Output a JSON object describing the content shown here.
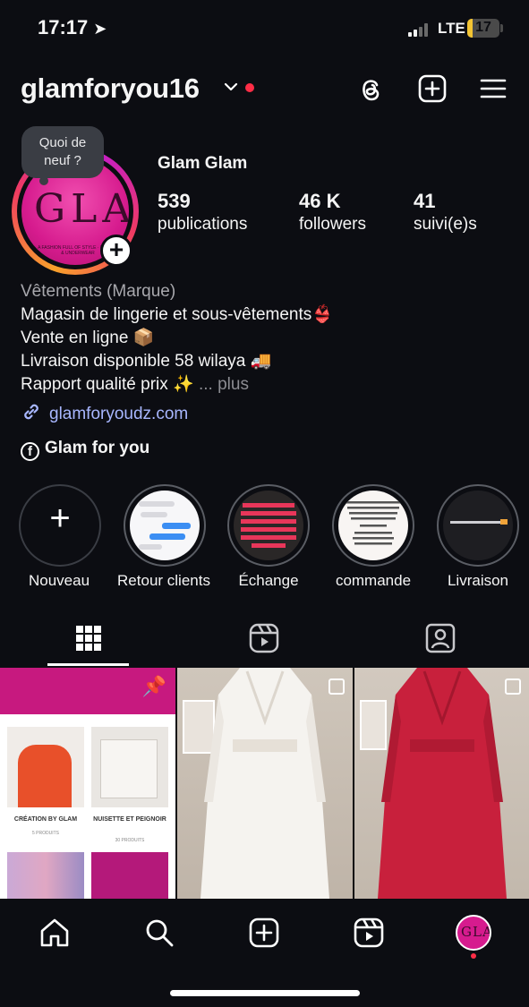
{
  "status_bar": {
    "time": "17:17",
    "location_icon": "location-arrow-icon",
    "network": "LTE",
    "battery": "17",
    "battery_level_percent": 17
  },
  "header": {
    "username": "glamforyou16",
    "dropdown_icon": "chevron-down-icon",
    "icons": [
      "threads-icon",
      "create-post-icon",
      "menu-icon"
    ]
  },
  "note": {
    "text_line1": "Quoi de",
    "text_line2": "neuf ?"
  },
  "avatar": {
    "logo_text": "GLAM",
    "tagline": "A FASHION FULL OF STYLE · PYJAMA & UNDERWEAR"
  },
  "profile": {
    "display_name": "Glam Glam",
    "stats": [
      {
        "value": "539",
        "label": "publications"
      },
      {
        "value": "46 K",
        "label": "followers"
      },
      {
        "value": "41",
        "label": "suivi(e)s"
      }
    ]
  },
  "bio": {
    "category": "Vêtements (Marque)",
    "lines": [
      "Magasin de lingerie et sous-vêtements👙",
      "Vente en ligne 📦",
      "Livraison disponible 58 wilaya 🚚",
      "Rapport qualité prix ✨"
    ],
    "more": "... plus",
    "link": "glamforyoudz.com",
    "facebook": "Glam for you"
  },
  "highlights": [
    {
      "label": "Nouveau"
    },
    {
      "label": "Retour clients"
    },
    {
      "label": "Échange",
      "preview": "Nous rappelons à notre chère clientè que ne nous faisons pas d'échange ni remboursement pour les commandes hors Alger"
    },
    {
      "label": "commande",
      "preview": "Pour toute commande se fait uniquement par message envoyez un MP avec l'article que vous avez choisi : Nom et prénom Adresse de livraison Num de téléphone"
    },
    {
      "label": "Livraison",
      "preview": "Livraison disponible 58 wilaya 🚚"
    }
  ],
  "tabs": [
    "grid-icon",
    "reels-icon",
    "tagged-icon"
  ],
  "posts": [
    {
      "pinned": true,
      "products": [
        {
          "title": "CRÉATION BY GLAM",
          "count": "5 PRODUITS"
        },
        {
          "title": "NUISETTE ET PEIGNOIR",
          "count": "30 PRODUITS"
        }
      ]
    },
    {
      "multi": true,
      "color": "#f2f0ec"
    },
    {
      "multi": true,
      "color": "#c8203c"
    }
  ],
  "bottom_nav": [
    "home-icon",
    "search-icon",
    "create-icon",
    "reels-icon",
    "profile-avatar"
  ],
  "colors": {
    "background": "#0c0d12",
    "link": "#a8b7ff",
    "accent_red": "#ff2d46",
    "brand_pink": "#d61b8e"
  }
}
